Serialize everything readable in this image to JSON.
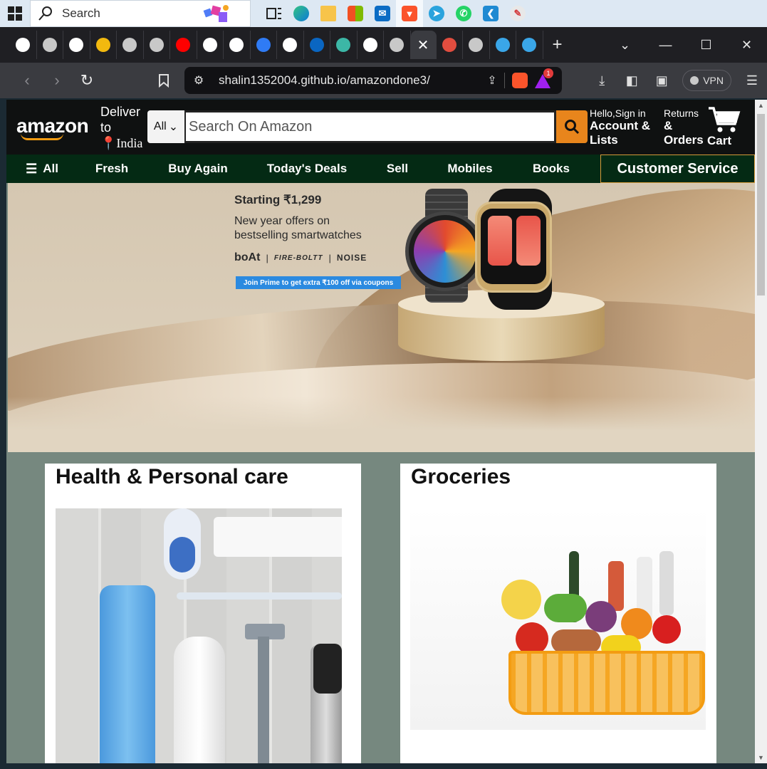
{
  "taskbar": {
    "search_label": "Search"
  },
  "browser": {
    "url": "shalin1352004.github.io/amazondone3/",
    "notification_count": "1",
    "vpn_label": "VPN",
    "tabs": [
      {
        "icon": "github-icon",
        "color": "#ffffff"
      },
      {
        "icon": "globe-icon",
        "color": "#c8c8c8"
      },
      {
        "icon": "chatgpt-icon",
        "color": "#ffffff"
      },
      {
        "icon": "colorful-app-icon",
        "color": "#f2b90f"
      },
      {
        "icon": "globe-icon",
        "color": "#c8c8c8"
      },
      {
        "icon": "globe-icon",
        "color": "#c8c8c8"
      },
      {
        "icon": "youtube-icon",
        "color": "#ff0000"
      },
      {
        "icon": "github-icon",
        "color": "#ffffff"
      },
      {
        "icon": "chatgpt-icon",
        "color": "#ffffff"
      },
      {
        "icon": "bookmark-app-icon",
        "color": "#2f7bf5"
      },
      {
        "icon": "github-icon",
        "color": "#ffffff"
      },
      {
        "icon": "linkedin-icon",
        "color": "#0a66c2"
      },
      {
        "icon": "cloud-app-icon",
        "color": "#3cb7a6"
      },
      {
        "icon": "github-icon",
        "color": "#ffffff"
      },
      {
        "icon": "globe-icon",
        "color": "#c8c8c8"
      }
    ],
    "tabs_after": [
      {
        "icon": "brave-shield-icon",
        "color": "#e14d3f"
      },
      {
        "icon": "globe-icon",
        "color": "#c8c8c8"
      },
      {
        "icon": "w-logo-icon",
        "color": "#3aa6e8"
      },
      {
        "icon": "w-logo-icon",
        "color": "#3aa6e8"
      }
    ]
  },
  "amazon": {
    "logo": "amazon",
    "deliver_to": "Deliver to",
    "deliver_location": "India",
    "search_category": "All",
    "search_placeholder": "Search On Amazon",
    "account_greeting": "Hello,Sign in",
    "account_title": "Account & Lists",
    "returns_small": "Returns",
    "returns_title": "& Orders",
    "cart_label": "Cart",
    "nav": [
      "All",
      "Fresh",
      "Buy Again",
      "Today's Deals",
      "Sell",
      "Mobiles",
      "Books"
    ],
    "customer_service": "Customer Service",
    "colors": {
      "header": "#0f1111",
      "nav": "#042a14",
      "search_btn": "#e8851c",
      "page_bg": "#76887f"
    }
  },
  "hero": {
    "headline": "Starting ₹1,299",
    "subtitle_line1": "New year offers on",
    "subtitle_line2": "bestselling smartwatches",
    "brand1": "boAt",
    "brand2": "FIRE-BOLTT",
    "brand3": "NOISE",
    "cta": "Join Prime to get extra ₹100 off via coupons"
  },
  "cards": [
    {
      "title": "Health & Personal care"
    },
    {
      "title": "Groceries"
    }
  ]
}
